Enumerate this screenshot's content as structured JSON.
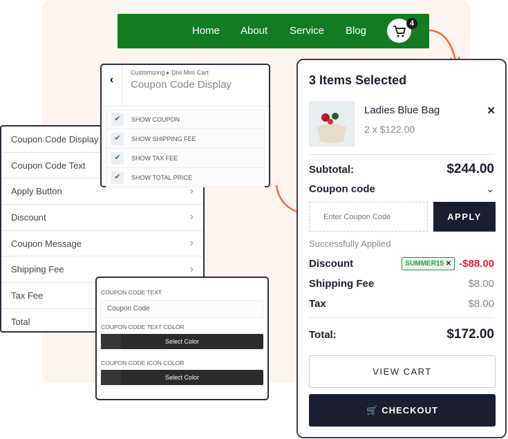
{
  "nav": {
    "items": [
      "Home",
      "About",
      "Service",
      "Blog"
    ],
    "cart_count": "4"
  },
  "settings_list": {
    "items": [
      "Coupon Code Display",
      "Coupon Code Text",
      "Apply Button",
      "Discount",
      "Coupon Message",
      "Shipping Fee",
      "Tax Fee",
      "Total"
    ]
  },
  "customizer": {
    "breadcrumb_root": "Customizing",
    "breadcrumb_sep": "▸",
    "breadcrumb_section": "Divi Mini Cart",
    "title": "Coupon Code Display",
    "options": [
      {
        "label": "SHOW COUPON",
        "checked": true
      },
      {
        "label": "SHOW SHIPPING FEE",
        "checked": true
      },
      {
        "label": "SHOW TAX FEE",
        "checked": true
      },
      {
        "label": "SHOW TOTAL PRICE",
        "checked": true
      }
    ]
  },
  "color_panel": {
    "text_label": "COUPON CODE TEXT",
    "text_value": "Coupon Code",
    "text_color_label": "COUPON CODE TEXT COLOR",
    "icon_color_label": "COUPON CODE ICON COLOR",
    "select_color": "Select Color"
  },
  "cart": {
    "title": "3 Items Selected",
    "product": {
      "name": "Ladies Blue Bag",
      "qty_price": "2 x $122.00"
    },
    "subtotal_label": "Subtotal:",
    "subtotal": "$244.00",
    "coupon_label": "Coupon code",
    "coupon_placeholder": "Enter Coupon Code",
    "apply": "APPLY",
    "status": "Successfully Applied",
    "discount_label": "Discount",
    "coupon_tag": "SUMMER15",
    "discount": "-$88.00",
    "shipping_label": "Shipping Fee",
    "shipping": "$8.00",
    "tax_label": "Tax",
    "tax": "$8.00",
    "total_label": "Total:",
    "total": "$172.00",
    "view_cart": "VIEW CART",
    "checkout": "CHECKOUT"
  },
  "colors": {
    "nav": "#137b22",
    "accent": "#f26b4a",
    "dark": "#1a1e2e",
    "discount": "#e8232f",
    "tag": "#2a9a4a"
  }
}
